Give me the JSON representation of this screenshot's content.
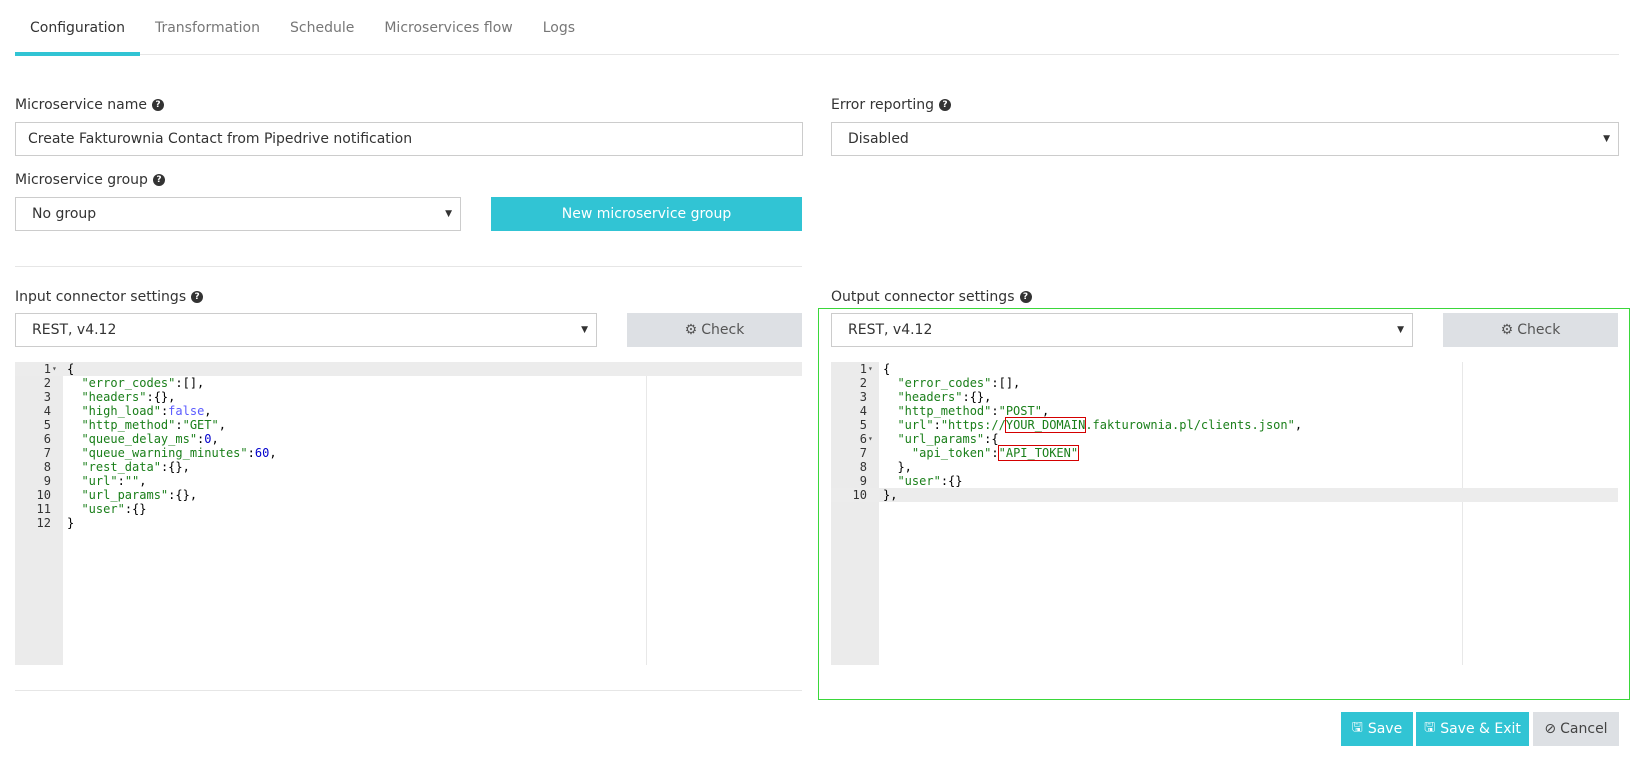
{
  "tabs": [
    {
      "label": "Configuration",
      "active": true
    },
    {
      "label": "Transformation",
      "active": false
    },
    {
      "label": "Schedule",
      "active": false
    },
    {
      "label": "Microservices flow",
      "active": false
    },
    {
      "label": "Logs",
      "active": false
    }
  ],
  "form": {
    "name_label": "Microservice name",
    "name_value": "Create Fakturownia Contact from Pipedrive notification",
    "error_label": "Error reporting",
    "error_value": "Disabled",
    "group_label": "Microservice group",
    "group_value": "No group",
    "new_group_button": "New microservice group"
  },
  "input": {
    "label": "Input connector settings",
    "connector": "REST, v4.12",
    "check_button": "Check"
  },
  "output": {
    "label": "Output connector settings",
    "connector": "REST, v4.12",
    "check_button": "Check"
  },
  "footer": {
    "save": "Save",
    "save_exit": "Save & Exit",
    "cancel": "Cancel"
  },
  "colors": {
    "accent": "#31c4d4",
    "focus_outline": "#3ad73a",
    "highlight_box": "#d40000"
  },
  "input_code": [
    [
      [
        "",
        "{"
      ]
    ],
    [
      [
        "",
        "  "
      ],
      [
        "s",
        "\"error_codes\""
      ],
      [
        "",
        ":[],"
      ]
    ],
    [
      [
        "",
        "  "
      ],
      [
        "s",
        "\"headers\""
      ],
      [
        "",
        ":{},"
      ]
    ],
    [
      [
        "",
        "  "
      ],
      [
        "s",
        "\"high_load\""
      ],
      [
        "",
        ":"
      ],
      [
        "k",
        "false"
      ],
      [
        "",
        ","
      ]
    ],
    [
      [
        "",
        "  "
      ],
      [
        "s",
        "\"http_method\""
      ],
      [
        "",
        ":"
      ],
      [
        "s",
        "\"GET\""
      ],
      [
        "",
        ","
      ]
    ],
    [
      [
        "",
        "  "
      ],
      [
        "s",
        "\"queue_delay_ms\""
      ],
      [
        "",
        ":"
      ],
      [
        "n",
        "0"
      ],
      [
        "",
        ","
      ]
    ],
    [
      [
        "",
        "  "
      ],
      [
        "s",
        "\"queue_warning_minutes\""
      ],
      [
        "",
        ":"
      ],
      [
        "n",
        "60"
      ],
      [
        "",
        ","
      ]
    ],
    [
      [
        "",
        "  "
      ],
      [
        "s",
        "\"rest_data\""
      ],
      [
        "",
        ":{},"
      ]
    ],
    [
      [
        "",
        "  "
      ],
      [
        "s",
        "\"url\""
      ],
      [
        "",
        ":"
      ],
      [
        "s",
        "\"\""
      ],
      [
        "",
        ","
      ]
    ],
    [
      [
        "",
        "  "
      ],
      [
        "s",
        "\"url_params\""
      ],
      [
        "",
        ":{},"
      ]
    ],
    [
      [
        "",
        "  "
      ],
      [
        "s",
        "\"user\""
      ],
      [
        "",
        ":{}"
      ]
    ],
    [
      [
        "",
        "}"
      ]
    ]
  ],
  "output_code": [
    [
      [
        "",
        "{"
      ]
    ],
    [
      [
        "",
        "  "
      ],
      [
        "s",
        "\"error_codes\""
      ],
      [
        "",
        ":[],"
      ]
    ],
    [
      [
        "",
        "  "
      ],
      [
        "s",
        "\"headers\""
      ],
      [
        "",
        ":{},"
      ]
    ],
    [
      [
        "",
        "  "
      ],
      [
        "s",
        "\"http_method\""
      ],
      [
        "",
        ":"
      ],
      [
        "s",
        "\"POST\""
      ],
      [
        "",
        ","
      ]
    ],
    [
      [
        "",
        "  "
      ],
      [
        "s",
        "\"url\""
      ],
      [
        "",
        ":"
      ],
      [
        "s",
        "\"https://"
      ],
      [
        "sb",
        "YOUR_DOMAIN"
      ],
      [
        "s",
        ".fakturownia.pl/clients.json\""
      ],
      [
        "",
        ","
      ]
    ],
    [
      [
        "",
        "  "
      ],
      [
        "s",
        "\"url_params\""
      ],
      [
        "",
        ":{"
      ]
    ],
    [
      [
        "",
        "    "
      ],
      [
        "s",
        "\"api_token\""
      ],
      [
        "",
        ":"
      ],
      [
        "sb",
        "\"API_TOKEN\""
      ]
    ],
    [
      [
        "",
        "  },"
      ]
    ],
    [
      [
        "",
        "  "
      ],
      [
        "s",
        "\"user\""
      ],
      [
        "",
        ":{}"
      ]
    ],
    [
      [
        "",
        "},"
      ]
    ]
  ]
}
